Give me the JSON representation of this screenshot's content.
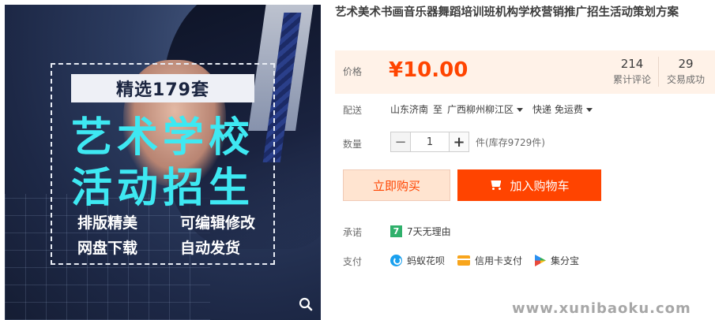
{
  "product_image": {
    "badge_text": "精选179套",
    "headline_line1": "艺术学校",
    "headline_line2": "活动招生",
    "features": [
      "排版精美",
      "可编辑修改",
      "网盘下载",
      "自动发货"
    ],
    "zoom_icon": "magnifier-icon"
  },
  "title": "艺术美术书画音乐器舞蹈培训班机构学校营销推广招生活动策划方案",
  "price": {
    "label": "价格",
    "value": "¥10.00",
    "reviews_count": "214",
    "reviews_label": "累计评论",
    "deals_count": "29",
    "deals_label": "交易成功"
  },
  "delivery": {
    "label": "配送",
    "from": "山东济南",
    "to_word": "至",
    "destination": "广西柳州柳江区",
    "shipping": "快递 免运费"
  },
  "quantity": {
    "label": "数量",
    "minus": "−",
    "value": "1",
    "plus": "+",
    "stock": "件(库存9729件)"
  },
  "actions": {
    "buy_now": "立即购买",
    "add_cart": "加入购物车"
  },
  "promise": {
    "label": "承诺",
    "badge": "7",
    "text": "7天无理由"
  },
  "payment": {
    "label": "支付",
    "methods": [
      "蚂蚁花呗",
      "信用卡支付",
      "集分宝"
    ]
  },
  "watermark": "www.xunibaoku.com",
  "colors": {
    "accent": "#ff4400",
    "price_bg": "#fff2e8",
    "headline": "#3ee8f2"
  }
}
